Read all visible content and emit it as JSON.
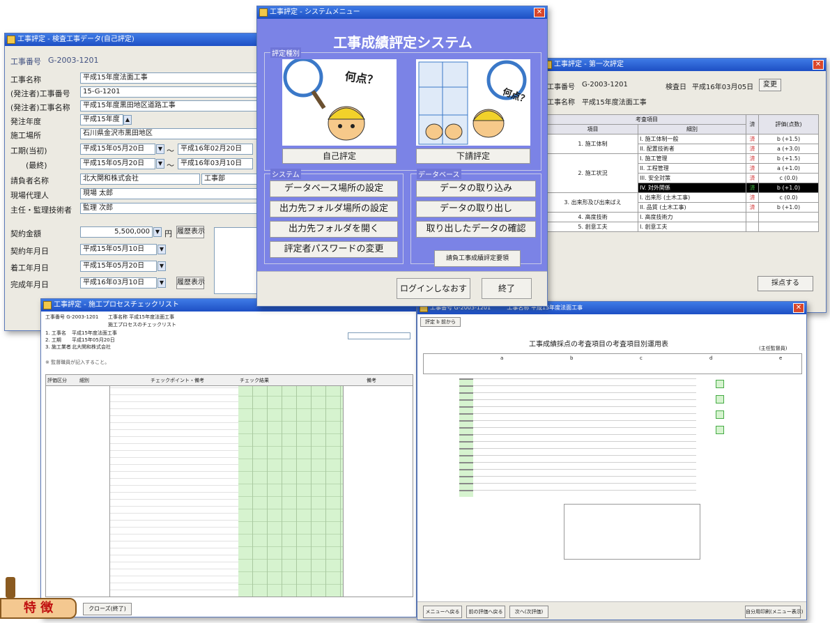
{
  "colors": {
    "title_bar": "#1d4fc4",
    "menu_bg": "#7b83e6",
    "selected_row": "#000000",
    "check_green": "#d6f3cf",
    "mark_red": "#d03030"
  },
  "self_eval_window": {
    "title": "工事評定 - 検査工事データ(自己評定)",
    "fields": [
      {
        "label": "工事番号",
        "value": "G-2003-1201"
      },
      {
        "label": "工事名称",
        "value": "平成15年度法面工事"
      },
      {
        "label": "(発注者)工事番号",
        "value": "15-G-1201"
      },
      {
        "label": "(発注者)工事名称",
        "value": "平成15年度黒田地区道路工事"
      },
      {
        "label": "発注年度",
        "value": "平成15年度"
      },
      {
        "label": "施工場所",
        "value": "石川県金沢市黒田地区"
      }
    ],
    "period_label": "工期(当初)",
    "period_final_label": "(最終)",
    "period_start": "平成15年05月20日",
    "period_end": "平成16年02月20日",
    "period_final_start": "平成15年05月20日",
    "period_final_end": "平成16年03月10日",
    "contractor_label": "請負者名称",
    "contractor": "北大関和株式会社",
    "contractor_dept": "工事部",
    "agent_label": "現場代理人",
    "agent": "現場 太郎",
    "engineer_label": "主任・監理技術者",
    "engineer": "監理 次郎",
    "amount_label": "契約金額",
    "amount": "5,500,000",
    "amount_unit": "円",
    "history_button": "履歴表示",
    "contract_date_label": "契約年月日",
    "contract_date": "平成15年05月10日",
    "start_date_label": "着工年月日",
    "start_date": "平成15年05月20日",
    "completion_date_label": "完成年月日",
    "completion_date": "平成16年03月10日",
    "history_button2": "履歴表示"
  },
  "system_menu": {
    "title": "工事評定 - システムメニュー",
    "heading": "工事成績評定システム",
    "eval_group_label": "評定種別",
    "what_score": "何点？",
    "self_eval_button": "自己評定",
    "sub_eval_button": "下請評定",
    "system_group_label": "システム",
    "system_buttons": [
      "データベース場所の設定",
      "出力先フォルダ場所の設定",
      "出力先フォルダを開く",
      "評定者パスワードの変更"
    ],
    "data_group_label": "データベース",
    "data_buttons": [
      "データの取り込み",
      "データの取り出し",
      "取り出したデータの確認"
    ],
    "contractor_table_button": "請負工事成績評定要領",
    "relogin_button": "ログインしなおす",
    "exit_button": "終了"
  },
  "first_eval_window": {
    "title": "工事評定 - 第一次評定",
    "work_no_label": "工事番号",
    "work_no": "G-2003-1201",
    "inspection_label": "検査日",
    "inspection_date": "平成16年03月05日",
    "change_button": "変更",
    "work_name_label": "工事名称",
    "work_name": "平成15年度法面工事",
    "col_category": "考査項目",
    "col_item": "項目",
    "col_detail": "細別",
    "col_mark": "済",
    "col_score": "評価(点数)",
    "rows": [
      {
        "item": "1. 施工体制",
        "detail": "I. 施工体制一般",
        "mark": "済",
        "score": "b (+1.5)"
      },
      {
        "item": "",
        "detail": "II. 配置技術者",
        "mark": "済",
        "score": "a (+3.0)"
      },
      {
        "item": "2. 施工状況",
        "detail": "I. 施工管理",
        "mark": "済",
        "score": "b (+1.5)"
      },
      {
        "item": "",
        "detail": "II. 工程管理",
        "mark": "済",
        "score": "a (+1.0)"
      },
      {
        "item": "",
        "detail": "III. 安全対策",
        "mark": "済",
        "score": "c (0.0)"
      },
      {
        "item": "",
        "detail": "IV. 対外関係",
        "mark": "済",
        "score": "b (+1.0)"
      },
      {
        "item": "3. 出来形及び出来ばえ",
        "detail": "I. 出来形 (土木工事)",
        "mark": "済",
        "score": "c (0.0)"
      },
      {
        "item": "",
        "detail": "II. 品質 (土木工事)",
        "mark": "済",
        "score": "b (+1.0)"
      },
      {
        "item": "4. 高度技術",
        "detail": "I. 高度技術力",
        "mark": "",
        "score": ""
      },
      {
        "item": "5. 創意工夫",
        "detail": "I. 創意工夫",
        "mark": "",
        "score": ""
      }
    ],
    "score_button": "採点する"
  },
  "checklist_window": {
    "title": "工事評定 - 施工プロセスチェックリスト",
    "work_no": "工事番号 G-2003-1201",
    "work_name": "工事名称 平成15年度法面工事",
    "subtitle": "施工プロセスのチェックリスト",
    "info_labels": [
      "1. 工事名",
      "2. 工期",
      "3. 施工業者"
    ],
    "info_values": [
      "平成15年度法面工事",
      "平成15年05月20日",
      "北大関和株式会社"
    ],
    "header_cols": [
      "評価",
      "区分",
      "細別",
      "チェックポイント・備考",
      "チェック結果",
      "備考"
    ],
    "notes": "※ 監督職員が記入すること。",
    "footer_button": "クローズ(終了)"
  },
  "criteria_window": {
    "title": "工事評定 - 考査項目別運用表",
    "work_no": "工事番号 G-2003-1201",
    "work_name": "工事名称 平成15年度法面工事",
    "toolbar": "評定 b 前から",
    "heading": "工事成績採点の考査項目の考査項目別運用表",
    "sub": "(主任監督員)",
    "grades": [
      "a",
      "b",
      "c",
      "d",
      "e"
    ],
    "footer_buttons": [
      "メニューへ戻る",
      "前の評価へ戻る",
      "次へ(次評価)"
    ],
    "footer_right": "自分用印刷(メニュー表示)"
  },
  "badge": {
    "text": "特 徴"
  }
}
